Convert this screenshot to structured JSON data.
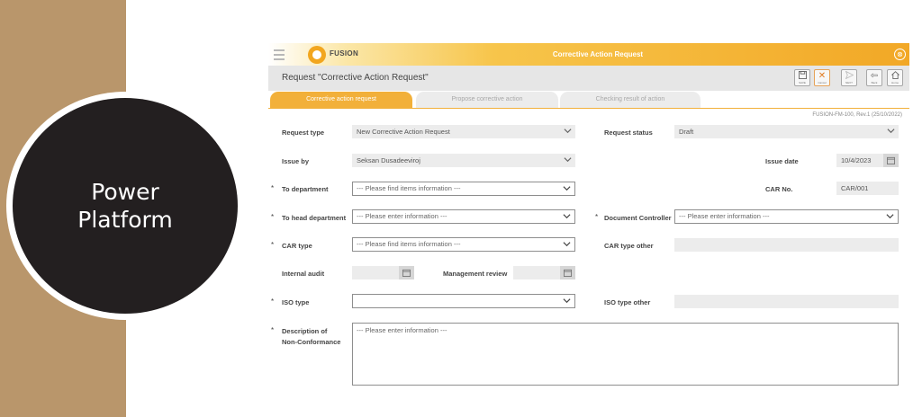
{
  "slide": {
    "badge_line1": "Power",
    "badge_line2": "Platform"
  },
  "topbar": {
    "logo_text": "FUSION",
    "title": "Corrective Action Request",
    "close_glyph": "⊗"
  },
  "header": {
    "page_title": "Request \"Corrective Action Request\""
  },
  "toolbar": {
    "save_label": "SAVE",
    "cancel_label": "Cancel",
    "next_label": "NEXT",
    "back_label": "Back",
    "home_label": "Home"
  },
  "tabs": [
    {
      "label": "Corrective action request",
      "active": true
    },
    {
      "label": "Propose corrective action",
      "active": false
    },
    {
      "label": "Checking result of action",
      "active": false
    }
  ],
  "doc_ref": "FUSION-FM-100, Rev.1 (25/10/2022)",
  "form": {
    "request_type": {
      "label": "Request type",
      "value": "New Corrective Action Request"
    },
    "request_status": {
      "label": "Request status",
      "value": "Draft"
    },
    "issue_by": {
      "label": "Issue by",
      "value": "Seksan Dusadeeviroj"
    },
    "issue_date": {
      "label": "Issue date",
      "value": "10/4/2023"
    },
    "to_department": {
      "label": "To department",
      "placeholder": "--- Please find items information ---"
    },
    "car_no": {
      "label": "CAR No.",
      "value": "CAR/001"
    },
    "to_head_department": {
      "label": "To head department",
      "placeholder": "--- Please enter information ---"
    },
    "document_controller": {
      "label": "Document Controller",
      "placeholder": "--- Please enter information ---"
    },
    "car_type": {
      "label": "CAR type",
      "placeholder": "--- Please find items information ---"
    },
    "car_type_other": {
      "label": "CAR type other",
      "value": ""
    },
    "internal_audit": {
      "label": "Internal audit",
      "value": ""
    },
    "management_review": {
      "label": "Management review",
      "value": ""
    },
    "iso_type": {
      "label": "ISO type",
      "placeholder": ""
    },
    "iso_type_other": {
      "label": "ISO type other",
      "value": ""
    },
    "description": {
      "label_line1": "Description of",
      "label_line2": "Non-Conformance",
      "placeholder": "--- Please enter information ---"
    },
    "required_mark": "*"
  },
  "icons": {
    "hamburger": "menu-icon",
    "save": "floppy-icon",
    "cancel": "x-icon",
    "next": "send-icon",
    "back": "arrow-left-icon",
    "home": "home-icon",
    "calendar": "calendar-icon",
    "dropdown": "chevron-down-icon"
  },
  "colors": {
    "accent": "#f2b03a",
    "slide_tan": "#b9966b",
    "badge_dark": "#231f20"
  }
}
